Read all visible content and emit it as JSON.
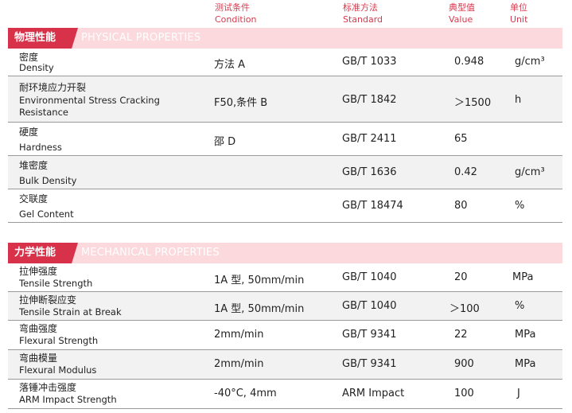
{
  "header": {
    "condition_zh": "测试条件",
    "condition_en": "Condition",
    "standard_zh": "标准方法",
    "standard_en": "Standard",
    "value_zh": "典型值",
    "value_en": "Value",
    "unit_zh": "单位",
    "unit_en": "Unit"
  },
  "physical": {
    "title_zh": "物理性能",
    "title_en": "PHYSICAL PROPERTIES",
    "rows": [
      {
        "zh": "密度",
        "en": "Density",
        "en2": "",
        "condition": "方法 A",
        "standard": "GB/T 1033",
        "value": "0.948",
        "unit": "g/cm³"
      },
      {
        "zh": "耐环境应力开裂",
        "en": "Environmental Stress Cracking",
        "en2": "Resistance",
        "condition": "F50,条件 B",
        "standard": "GB/T 1842",
        "value": "＞1500",
        "unit": "h"
      },
      {
        "zh": "硬度",
        "en": "Hardness",
        "en2": "",
        "condition": "邵 D",
        "standard": "GB/T 2411",
        "value": "65",
        "unit": ""
      },
      {
        "zh": "堆密度",
        "en": "Bulk Density",
        "en2": "",
        "condition": "",
        "standard": "GB/T 1636",
        "value": "0.42",
        "unit": "g/cm³"
      },
      {
        "zh": "交联度",
        "en": "Gel Content",
        "en2": "",
        "condition": "",
        "standard": "GB/T 18474",
        "value": "80",
        "unit": "%"
      }
    ]
  },
  "mechanical": {
    "title_zh": "力学性能",
    "title_en": "MECHANICAL PROPERTIES",
    "rows": [
      {
        "zh": "拉伸强度",
        "en": "Tensile Strength",
        "condition": "1A 型, 50mm/min",
        "standard": "GB/T 1040",
        "value": "20",
        "unit": "MPa"
      },
      {
        "zh": "拉伸断裂应变",
        "en": "Tensile Strain at Break",
        "condition": "1A 型, 50mm/min",
        "standard": "GB/T 1040",
        "value": "＞100",
        "unit": "%"
      },
      {
        "zh": "弯曲强度",
        "en": "Flexural Strength",
        "condition": "2mm/min",
        "standard": "GB/T 9341",
        "value": "22",
        "unit": "MPa"
      },
      {
        "zh": "弯曲模量",
        "en": "Flexural Modulus",
        "condition": "2mm/min",
        "standard": "GB/T 9341",
        "value": "900",
        "unit": "MPa"
      },
      {
        "zh": "落锤冲击强度",
        "en": "ARM Impact Strength",
        "condition": "-40°C, 4mm",
        "standard": "ARM Impact",
        "value": "100",
        "unit": "J"
      }
    ]
  }
}
